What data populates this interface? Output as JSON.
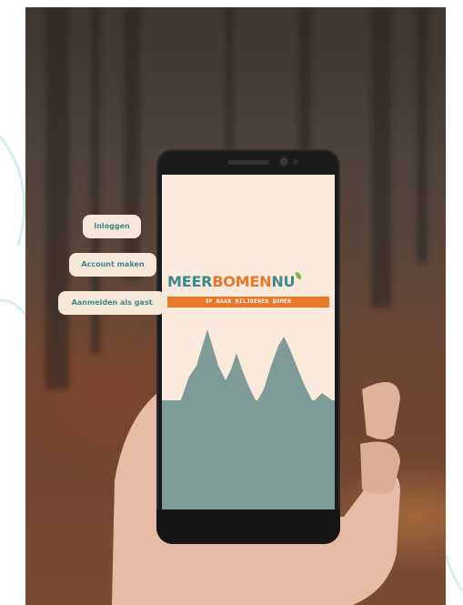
{
  "app": {
    "logo": {
      "word1": "MEER",
      "word2": "BOMEN",
      "word3": "NU"
    },
    "tagline": "OP NAAR MILJOENEN BOMEN",
    "buttons": {
      "login": "Inloggen",
      "learn": "Account maken",
      "guest": "Aanmelden als gast"
    }
  },
  "colors": {
    "teal": "#3d8a8a",
    "orange": "#e8782a",
    "screen_background": "#fbe9dc",
    "forest_silhouette": "#7f9b98",
    "button_fill": "#f7e7d8",
    "leaf_accent": "#7cb84a"
  },
  "icons": {
    "logo_leaf": "leaf-icon",
    "phone_camera": "camera-icon"
  }
}
